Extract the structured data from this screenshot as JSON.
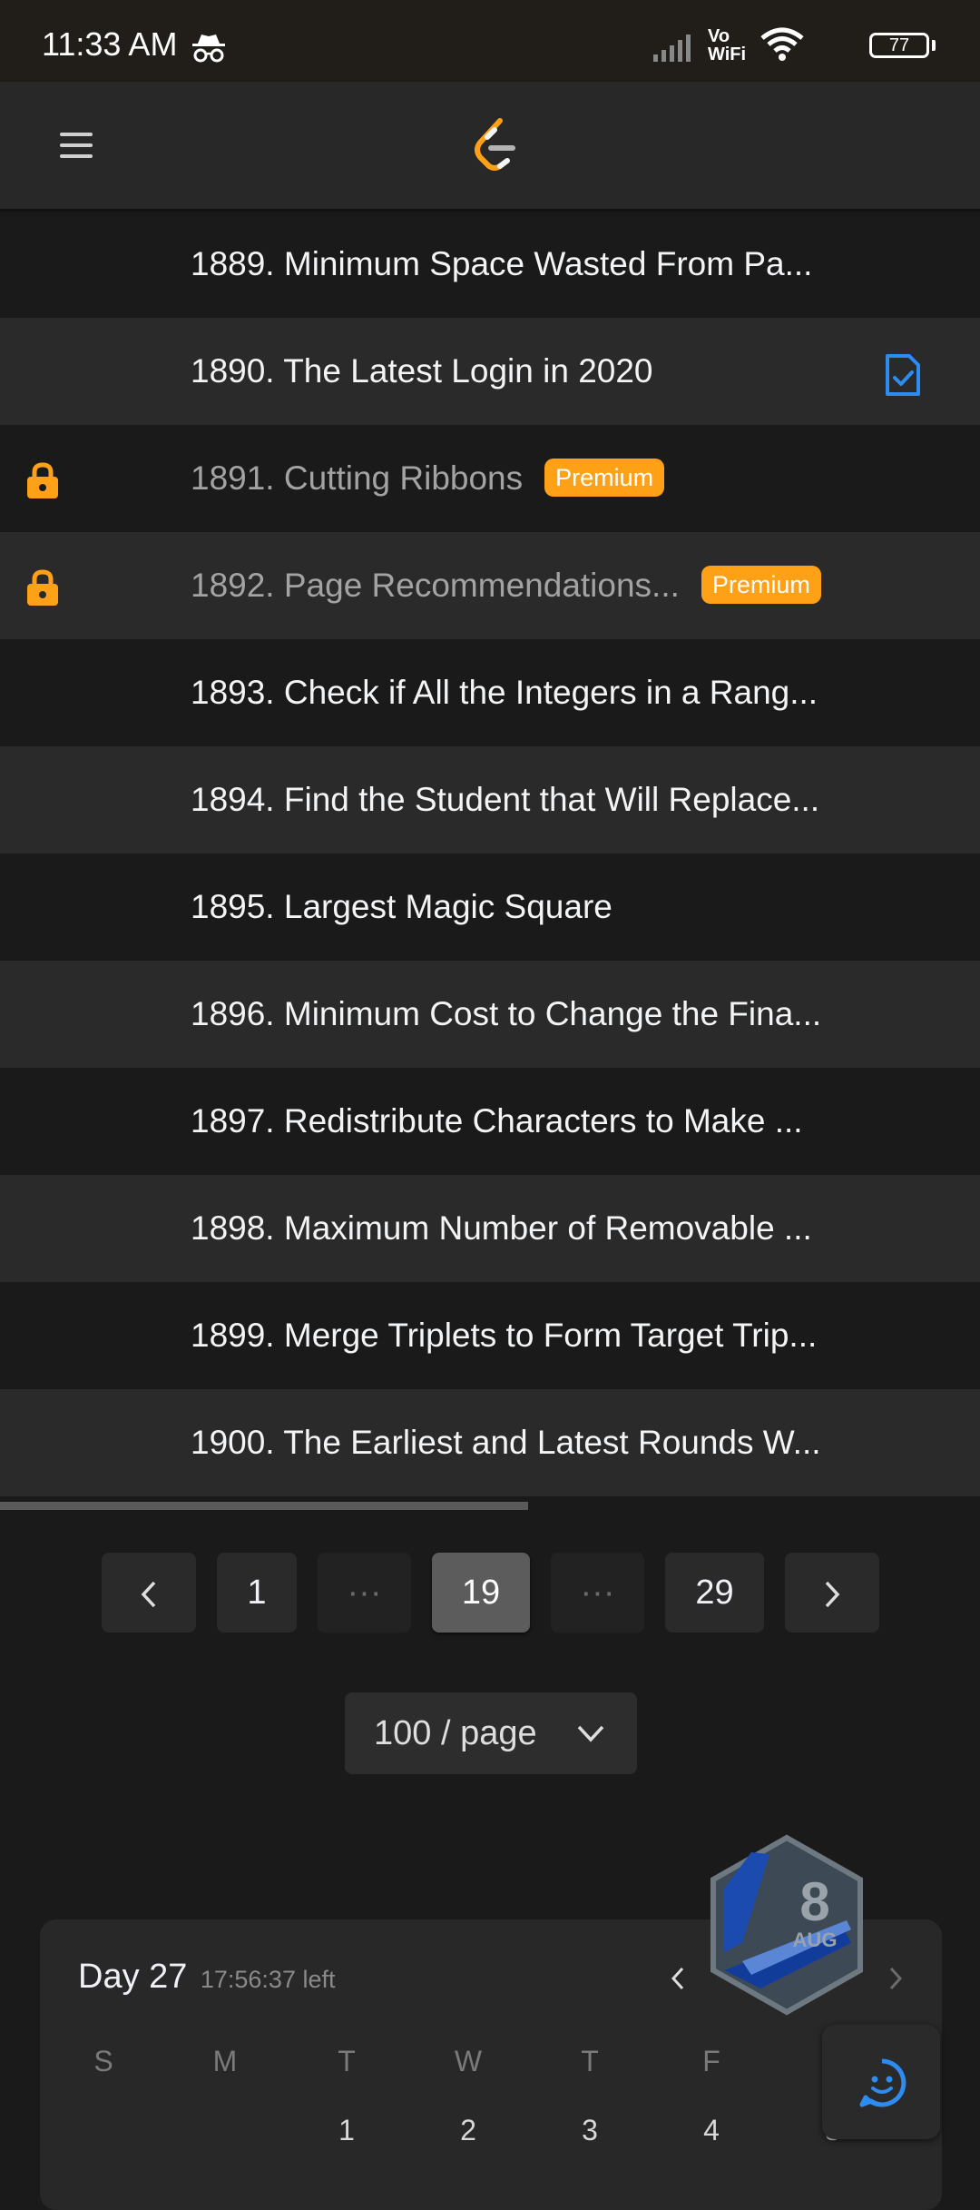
{
  "status_bar": {
    "time": "11:33 AM",
    "battery": "77",
    "network_label_top": "Vo",
    "network_label_bottom": "WiFi"
  },
  "problems": [
    {
      "title": "1889. Minimum Space Wasted From Pa...",
      "locked": false,
      "premium": false,
      "solved": false
    },
    {
      "title": "1890. The Latest Login in 2020",
      "locked": false,
      "premium": false,
      "solved": true
    },
    {
      "title": "1891. Cutting Ribbons",
      "locked": true,
      "premium": true,
      "solved": false
    },
    {
      "title": "1892. Page Recommendations...",
      "locked": true,
      "premium": true,
      "solved": false
    },
    {
      "title": "1893. Check if All the Integers in a Rang...",
      "locked": false,
      "premium": false,
      "solved": false
    },
    {
      "title": "1894. Find the Student that Will Replace...",
      "locked": false,
      "premium": false,
      "solved": false
    },
    {
      "title": "1895. Largest Magic Square",
      "locked": false,
      "premium": false,
      "solved": false
    },
    {
      "title": "1896. Minimum Cost to Change the Fina...",
      "locked": false,
      "premium": false,
      "solved": false
    },
    {
      "title": "1897. Redistribute Characters to Make ...",
      "locked": false,
      "premium": false,
      "solved": false
    },
    {
      "title": "1898. Maximum Number of Removable ...",
      "locked": false,
      "premium": false,
      "solved": false
    },
    {
      "title": "1899. Merge Triplets to Form Target Trip...",
      "locked": false,
      "premium": false,
      "solved": false
    },
    {
      "title": "1900. The Earliest and Latest Rounds W...",
      "locked": false,
      "premium": false,
      "solved": false
    }
  ],
  "premium_label": "Premium",
  "pagination": {
    "first": "1",
    "current": "19",
    "last": "29",
    "ellipsis": "···"
  },
  "page_size": {
    "selected": "100 / page"
  },
  "calendar": {
    "day_label": "Day 27",
    "time_left": "17:56:37 left",
    "weekdays": [
      "S",
      "M",
      "T",
      "W",
      "T",
      "F",
      "S"
    ],
    "dates": [
      "1",
      "2",
      "3",
      "4",
      "5"
    ]
  },
  "monthly_badge": {
    "number": "8",
    "month": "AUG"
  },
  "colors": {
    "accent": "#ffa116",
    "solved_blue": "#2d8cf0",
    "background": "#1a1a1a",
    "row_alt": "#2a2a2a"
  }
}
